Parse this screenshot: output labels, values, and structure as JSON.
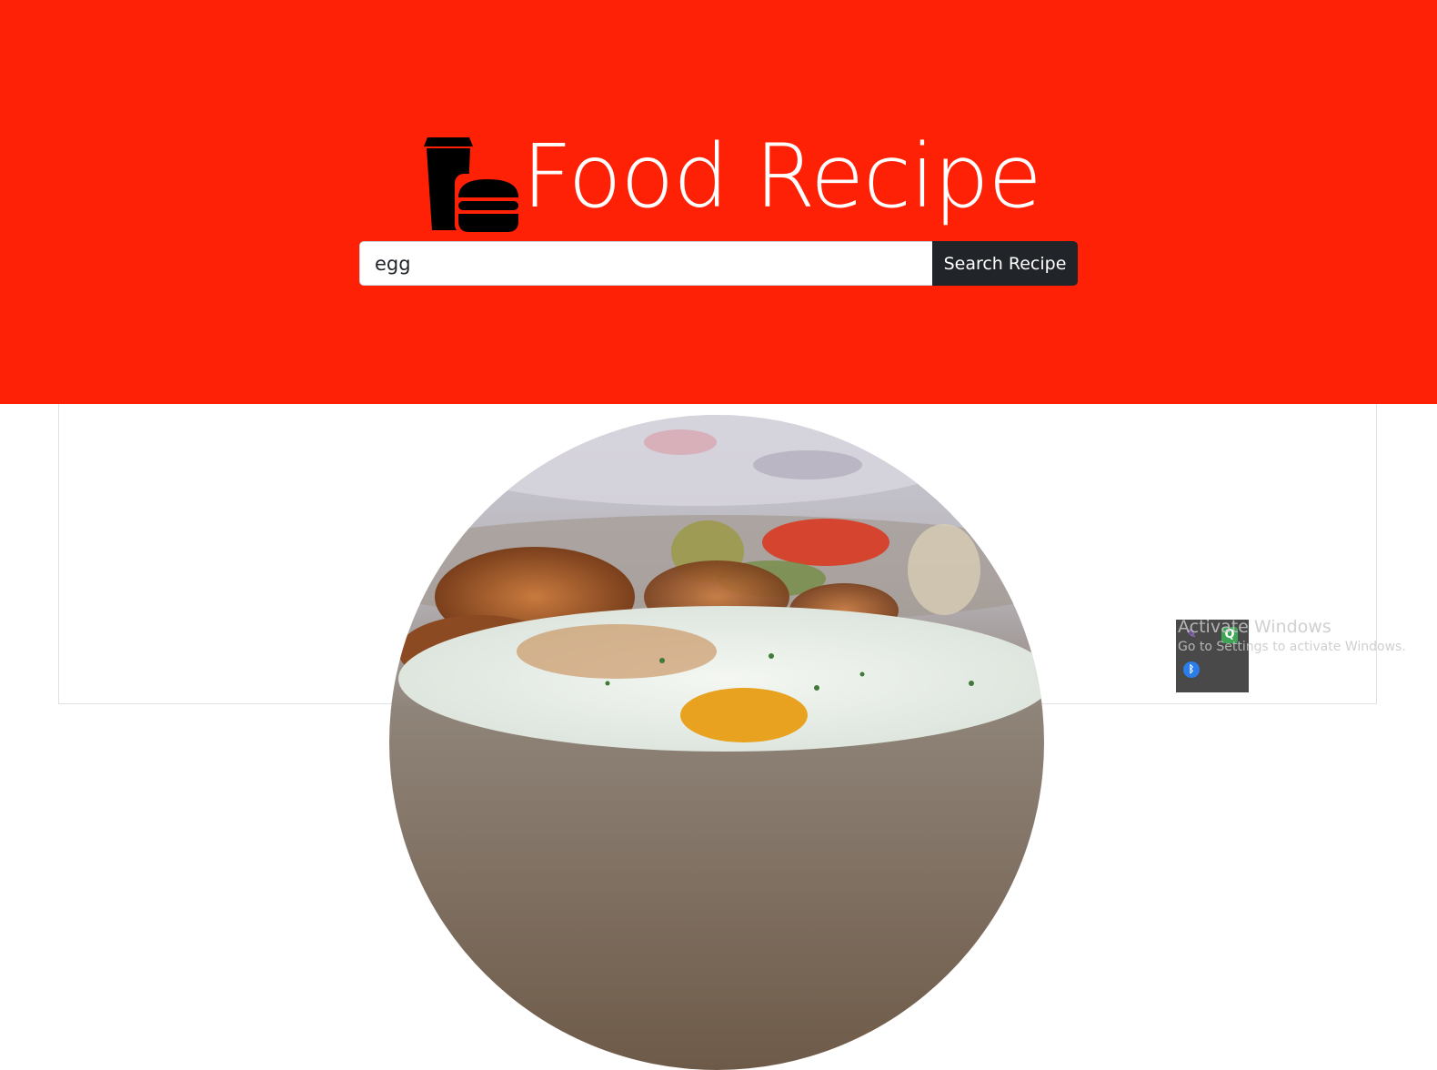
{
  "header": {
    "title": "Food Recipe",
    "logo_icon": "food-drink-burger-icon",
    "background_color": "#ff2106"
  },
  "search": {
    "value": "egg",
    "button_label": "Search Recipe"
  },
  "results": {
    "image_icon": "fried-egg-plate-photo"
  },
  "system_overlay": {
    "watermark_title": "Activate Windows",
    "watermark_subtitle": "Go to Settings to activate Windows.",
    "tray_icons": [
      "pen-icon",
      "q-app-icon",
      "bluetooth-icon"
    ]
  }
}
